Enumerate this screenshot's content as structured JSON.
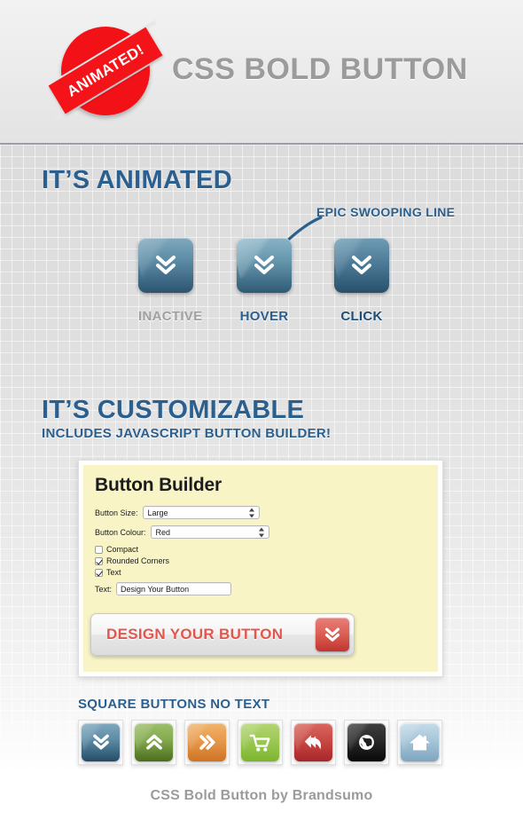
{
  "header": {
    "badge_text": "ANIMATED!",
    "title": "CSS BOLD BUTTON",
    "badge_color": "#f41319",
    "title_color": "#9b9b9b"
  },
  "sections": {
    "animated": {
      "title": "IT’S ANIMATED",
      "annotation": "EPIC SWOOPING LINE",
      "accent_color": "#2b5f8e",
      "states": [
        {
          "label": "INACTIVE",
          "icon": "double-chevron-down-icon"
        },
        {
          "label": "HOVER",
          "icon": "double-chevron-down-icon"
        },
        {
          "label": "CLICK",
          "icon": "double-chevron-down-icon"
        }
      ]
    },
    "customizable": {
      "title": "IT’S CUSTOMIZABLE",
      "subtitle": "INCLUDES JAVASCRIPT BUTTON BUILDER!"
    },
    "square": {
      "title": "SQUARE BUTTONS NO TEXT",
      "buttons": [
        {
          "name": "chevron-down",
          "icon": "double-chevron-down-icon",
          "color": "#5d8ca6"
        },
        {
          "name": "chevron-up",
          "icon": "double-chevron-up-icon",
          "color": "#85ab4f"
        },
        {
          "name": "chevron-right",
          "icon": "double-chevron-right-icon",
          "color": "#e89b4d"
        },
        {
          "name": "cart",
          "icon": "shopping-cart-icon",
          "color": "#9ec957"
        },
        {
          "name": "reply",
          "icon": "reply-arrow-icon",
          "color": "#c94b45"
        },
        {
          "name": "globe",
          "icon": "globe-icon",
          "color": "#2b2b2b"
        },
        {
          "name": "home",
          "icon": "home-icon",
          "color": "#a8c7da"
        }
      ]
    }
  },
  "builder": {
    "title": "Button Builder",
    "fields": {
      "size_label": "Button Size:",
      "size_value": "Large",
      "colour_label": "Button Colour:",
      "colour_value": "Red",
      "text_label": "Text:",
      "text_value": "Design Your Button"
    },
    "checkboxes": [
      {
        "label": "Compact",
        "checked": false
      },
      {
        "label": "Rounded Corners",
        "checked": true
      },
      {
        "label": "Text",
        "checked": true
      }
    ],
    "preview": {
      "label": "DESIGN YOUR BUTTON",
      "icon": "double-chevron-down-icon",
      "color": "#c0352f"
    },
    "panel_color": "#f8f4c6"
  },
  "footer": {
    "text": "CSS Bold Button by Brandsumo"
  }
}
